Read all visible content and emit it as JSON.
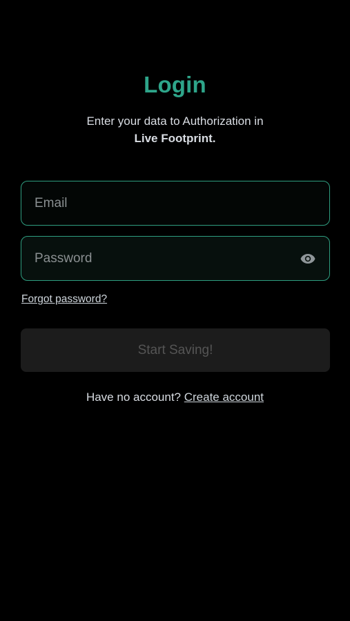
{
  "header": {
    "title": "Login",
    "subtitle_line1": "Enter your data to Authorization in",
    "subtitle_line2": "Live Footprint."
  },
  "form": {
    "email": {
      "value": "",
      "placeholder": "Email"
    },
    "password": {
      "value": "",
      "placeholder": "Password",
      "toggle_icon": "eye-icon"
    },
    "forgot_label": "Forgot password?",
    "submit_label": "Start Saving!"
  },
  "footer": {
    "prompt": "Have no account?",
    "link_label": "Create account"
  },
  "colors": {
    "accent": "#2ea58a",
    "field_border": "#2f9e80",
    "background": "#000000",
    "button_disabled_bg": "#1c1c1c",
    "button_disabled_text": "#555555"
  }
}
